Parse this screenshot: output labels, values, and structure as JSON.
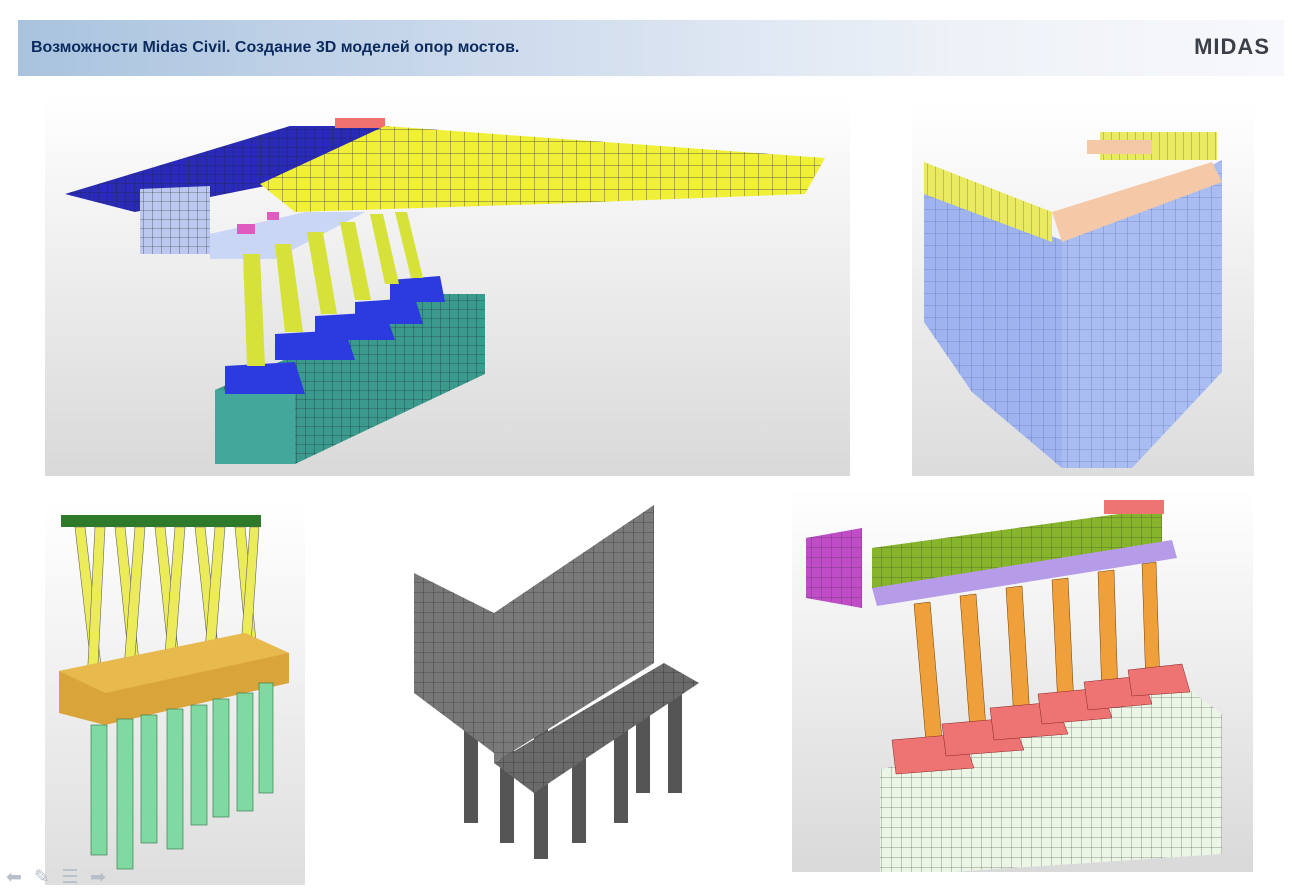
{
  "header": {
    "title": "Возможности Midas Civil. Создание 3D моделей опор мостов.",
    "logo": "MIDAS"
  },
  "figures": [
    {
      "name": "pier-model-with-deck"
    },
    {
      "name": "wall-pier-on-pile-group"
    },
    {
      "name": "inclined-pile-pier"
    },
    {
      "name": "abutment-mesh"
    },
    {
      "name": "multi-column-pier"
    }
  ],
  "navigation": {
    "prev_icon": "arrow-left-icon",
    "pen_icon": "pen-icon",
    "menu_icon": "menu-icon",
    "next_icon": "arrow-right-icon"
  },
  "colors": {
    "header_text": "#0b2b5e",
    "deck_yellow": "#f1f038",
    "deck_blue": "#2a2ab8",
    "pile_cap_teal": "#3a9a8e",
    "pier_footing_blue": "#2b3be0",
    "column_green": "#d6e23a",
    "pile_blue": "#9fb3ef",
    "pile_green": "#7fd99a",
    "mesh_gray": "#6c6c6c",
    "column_orange": "#f0a03a",
    "footing_pink": "#ee7474",
    "cap_purple": "#b69be8"
  }
}
